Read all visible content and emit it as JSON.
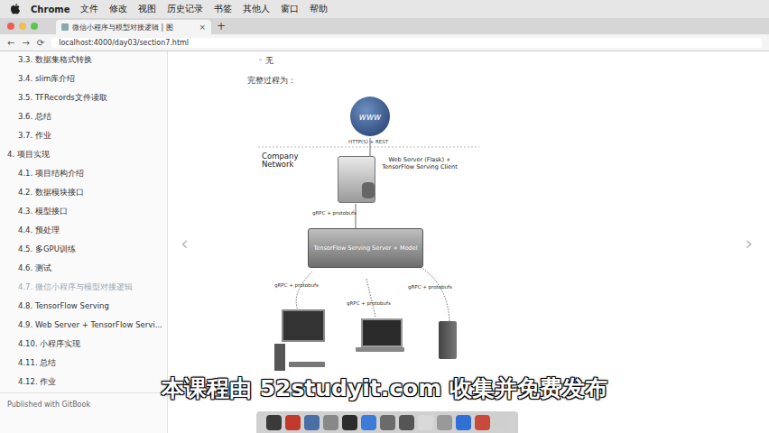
{
  "menubar": {
    "app": "Chrome",
    "items": [
      "文件",
      "修改",
      "视图",
      "历史记录",
      "书签",
      "其他人",
      "窗口",
      "帮助"
    ]
  },
  "tab": {
    "title": "微信小程序与模型对接逻辑 | 图",
    "close": "×",
    "new": "+"
  },
  "nav": {
    "back": "←",
    "forward": "→",
    "reload": "⟳",
    "url": "localhost:4000/day03/section7.html"
  },
  "sidebar": {
    "items": [
      {
        "label": "3.3. 数据集格式转换",
        "kind": "section",
        "selected": false
      },
      {
        "label": "3.4. slim库介绍",
        "kind": "section",
        "selected": false
      },
      {
        "label": "3.5. TFRecords文件读取",
        "kind": "section",
        "selected": false
      },
      {
        "label": "3.6. 总结",
        "kind": "section",
        "selected": false
      },
      {
        "label": "3.7. 作业",
        "kind": "section",
        "selected": false
      },
      {
        "label": "4. 项目实现",
        "kind": "chapter",
        "selected": false
      },
      {
        "label": "4.1. 项目结构介绍",
        "kind": "section",
        "selected": false
      },
      {
        "label": "4.2. 数据模块接口",
        "kind": "section",
        "selected": false
      },
      {
        "label": "4.3. 模型接口",
        "kind": "section",
        "selected": false
      },
      {
        "label": "4.4. 预处理",
        "kind": "section",
        "selected": false
      },
      {
        "label": "4.5. 多GPU训练",
        "kind": "section",
        "selected": false
      },
      {
        "label": "4.6. 测试",
        "kind": "section",
        "selected": false
      },
      {
        "label": "4.7. 微信小程序与模型对接逻辑",
        "kind": "section",
        "selected": true
      },
      {
        "label": "4.8. TensorFlow Serving",
        "kind": "section",
        "selected": false
      },
      {
        "label": "4.9. Web Server + TensorFlow Servi...",
        "kind": "section",
        "selected": false
      },
      {
        "label": "4.10. 小程序实现",
        "kind": "section",
        "selected": false
      },
      {
        "label": "4.11. 总结",
        "kind": "section",
        "selected": false
      },
      {
        "label": "4.12. 作业",
        "kind": "section",
        "selected": false
      }
    ],
    "footer": "Published with GitBook"
  },
  "content": {
    "bullet": "◦",
    "bullet_text": "无",
    "intro": "完整过程为：",
    "prev": "‹",
    "next": "›"
  },
  "diagram": {
    "http": "HTTP(S) + REST",
    "network": "Company Network",
    "web_server": "Web Server (Flask) + TensorFlow Serving Client",
    "grpc": "gRPC + protobufs",
    "serving": "TensorFlow Serving Server + Model",
    "globe": "www"
  },
  "subtitle": "本课程由 52studyit.com 收集并免费发布"
}
